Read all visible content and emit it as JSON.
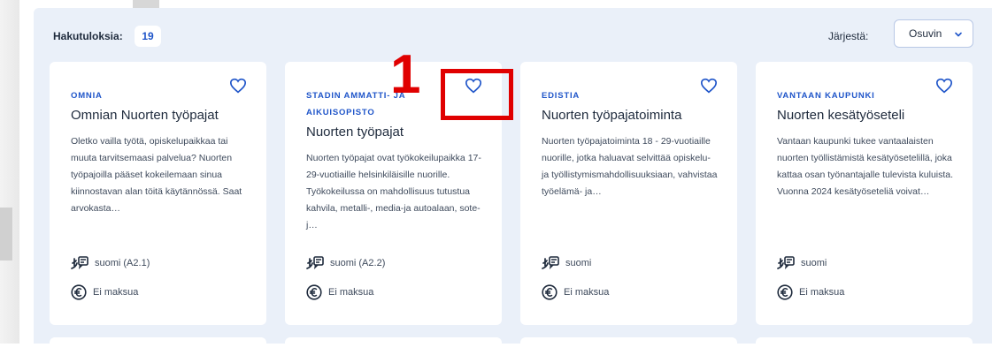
{
  "results": {
    "label": "Hakutuloksia:",
    "count": "19"
  },
  "sort": {
    "label": "Järjestä:",
    "selected": "Osuvin"
  },
  "cards": [
    {
      "provider": "OMNIA",
      "title": "Omnian Nuorten työpajat",
      "description": "Oletko vailla työtä, opiskelupaikkaa tai muuta tarvitsemaasi palvelua? Nuorten työpajoilla pääset kokeilemaan sinua kiinnostavan alan töitä käytännössä. Saat arvokasta…",
      "language": "suomi (A2.1)",
      "price": "Ei maksua"
    },
    {
      "provider": "STADIN AMMATTI- JA AIKUISOPISTO",
      "title": "Nuorten työpajat",
      "description": "Nuorten työpajat ovat työkokeilupaikka 17-29-vuotiaille helsinkiläisille nuorille. Työkokeilussa on mahdollisuus tutustua kahvila, metalli-, media-ja autoalaan, sote- j…",
      "language": "suomi (A2.2)",
      "price": "Ei maksua"
    },
    {
      "provider": "EDISTIA",
      "title": "Nuorten työpajatoiminta",
      "description": "Nuorten työpajatoiminta 18 - 29-vuotiaille nuorille, jotka haluavat selvittää opiskelu- ja työllistymismahdollisuuksiaan, vahvistaa työelämä- ja…",
      "language": "suomi",
      "price": "Ei maksua"
    },
    {
      "provider": "VANTAAN KAUPUNKI",
      "title": "Nuorten kesätyöseteli",
      "description": "Vantaan kaupunki tukee vantaalaisten nuorten työllistämistä kesätyösetelillä, joka kattaa osan työnantajalle tulevista kuluista. Vuonna 2024 kesätyöseteliä voivat…",
      "language": "suomi",
      "price": "Ei maksua"
    }
  ],
  "annotation": {
    "number": "1",
    "color": "#e00000"
  },
  "colors": {
    "accent": "#1f55c9",
    "panel": "#eaf0f9",
    "text": "#1e2a3c"
  },
  "icons": {
    "favorite": "heart-outline-icon",
    "language": "language-speech-icon",
    "price": "euro-icon",
    "sort": "chevron-down-icon"
  }
}
